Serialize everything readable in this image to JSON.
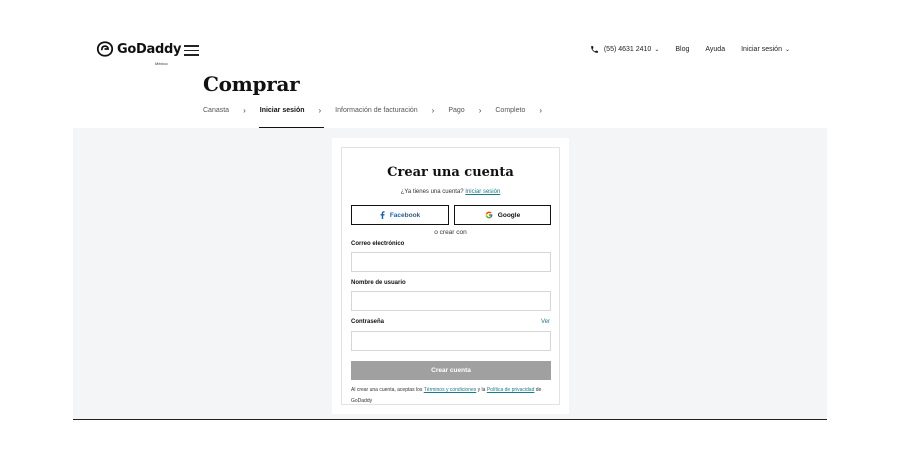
{
  "header": {
    "logo_text": "GoDaddy",
    "logo_region": "México",
    "nav": {
      "phone": "(55) 4631 2410",
      "blog": "Blog",
      "help": "Ayuda",
      "sign_in": "Iniciar sesión"
    }
  },
  "page": {
    "title": "Comprar",
    "steps": [
      {
        "label": "Canasta",
        "active": false
      },
      {
        "label": "Iniciar sesión",
        "active": true
      },
      {
        "label": "Información de facturación",
        "active": false
      },
      {
        "label": "Pago",
        "active": false
      },
      {
        "label": "Completo",
        "active": false
      }
    ],
    "step_separator": "›"
  },
  "form": {
    "title": "Crear una cuenta",
    "have_account_text": "¿Ya tienes una cuenta?",
    "have_account_link": "Iniciar sesión",
    "facebook_label": "Facebook",
    "google_label": "Google",
    "or_create": "o crear con",
    "email_label": "Correo electrónico",
    "email_value": "",
    "username_label": "Nombre de usuario",
    "username_value": "",
    "password_label": "Contraseña",
    "password_value": "",
    "show_password": "Ver",
    "submit_label": "Crear cuenta",
    "terms_prefix": "Al crear una cuenta, aceptas los",
    "terms_link": "Términos y condiciones",
    "terms_and": "y la",
    "privacy_link": "Política de privacidad",
    "terms_suffix": "de GoDaddy"
  },
  "colors": {
    "link": "#1a7b8a",
    "facebook": "#1f5fa8",
    "disabled_button": "#a0a0a0",
    "background_gray": "#f4f5f6"
  },
  "icons": [
    "godaddy-logo-icon",
    "menu-icon",
    "phone-icon",
    "chevron-down-icon",
    "facebook-icon",
    "google-icon"
  ]
}
